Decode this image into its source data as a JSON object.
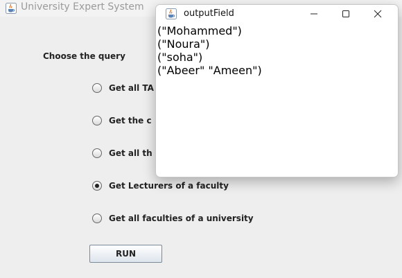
{
  "main_window": {
    "title": "University Expert System",
    "query_label": "Choose the query",
    "options": [
      {
        "label": "Get all TA",
        "checked": false
      },
      {
        "label": "Get the c",
        "checked": false
      },
      {
        "label": "Get all th",
        "checked": false
      },
      {
        "label": "Get Lecturers of a faculty",
        "checked": true
      },
      {
        "label": "Get all faculties of a university",
        "checked": false
      }
    ],
    "run_label": "RUN"
  },
  "output_window": {
    "title": "outputField",
    "lines": [
      "(\"Mohammed\")",
      "(\"Noura\")",
      "(\"soha\")",
      "(\"Abeer\" \"Ameen\")"
    ],
    "controls": [
      "minimize-icon",
      "maximize-icon",
      "close-icon"
    ]
  },
  "icons": {
    "app_icon": "java-coffee-cup-icon"
  },
  "colors": {
    "main_bg": "#eeeeee",
    "output_bg": "#ffffff",
    "title_text_inactive": "#9a9a9a"
  }
}
